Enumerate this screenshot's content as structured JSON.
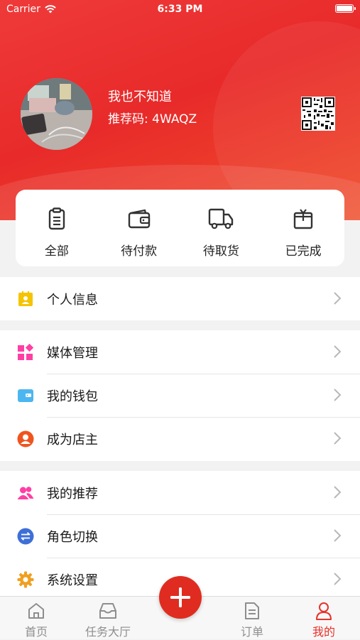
{
  "status_bar": {
    "carrier": "Carrier",
    "time": "6:33 PM"
  },
  "profile": {
    "name": "我也不知道",
    "referral_code": "推荐码: 4WAQZ"
  },
  "orders": [
    {
      "label": "全部",
      "icon": "clipboard-icon"
    },
    {
      "label": "待付款",
      "icon": "wallet-icon"
    },
    {
      "label": "待取货",
      "icon": "truck-icon"
    },
    {
      "label": "已完成",
      "icon": "box-icon"
    }
  ],
  "menu": {
    "group1": [
      {
        "label": "个人信息",
        "icon": "id-card-icon",
        "color": "#f5c400"
      }
    ],
    "group2": [
      {
        "label": "媒体管理",
        "icon": "grid-icon",
        "color": "#ff3fa4"
      },
      {
        "label": "我的钱包",
        "icon": "wallet-icon",
        "color": "#4cb6f0"
      },
      {
        "label": "成为店主",
        "icon": "user-circle-icon",
        "color": "#f0541e"
      }
    ],
    "group3": [
      {
        "label": "我的推荐",
        "icon": "users-icon",
        "color": "#ff3fa4"
      },
      {
        "label": "角色切换",
        "icon": "switch-icon",
        "color": "#3d6fd8"
      },
      {
        "label": "系统设置",
        "icon": "gear-icon",
        "color": "#f0a020"
      }
    ]
  },
  "tabbar": [
    {
      "label": "首页",
      "icon": "home-icon"
    },
    {
      "label": "任务大厅",
      "icon": "inbox-icon"
    },
    {
      "label": "订单",
      "icon": "document-icon"
    },
    {
      "label": "我的",
      "icon": "user-icon",
      "active": true
    }
  ],
  "colors": {
    "brand_red": "#e8312a",
    "fab": "#e02c20"
  }
}
